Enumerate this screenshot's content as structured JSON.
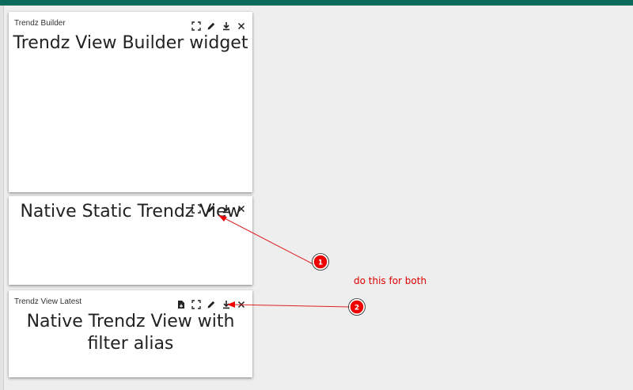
{
  "widgets": [
    {
      "title": "Trendz Builder",
      "content": "Trendz View Builder widget",
      "toolbar": [
        "fullscreen-icon",
        "edit-icon",
        "download-icon",
        "close-icon"
      ]
    },
    {
      "title": "",
      "content": "Native Static Trendz View",
      "toolbar": [
        "fullscreen-icon",
        "edit-icon",
        "download-icon",
        "close-icon"
      ]
    },
    {
      "title": "Trendz View Latest",
      "content_line1": "Native Trendz View with",
      "content_line2": "filter alias",
      "toolbar": [
        "export-file-icon",
        "fullscreen-icon",
        "edit-icon",
        "download-icon",
        "close-icon"
      ]
    }
  ],
  "annotations": {
    "markers": [
      "1",
      "2"
    ],
    "note": "do this for both",
    "color": "#e00000"
  },
  "colors": {
    "topbar": "#0b6b5a",
    "background": "#eeeeee",
    "card": "#ffffff"
  }
}
